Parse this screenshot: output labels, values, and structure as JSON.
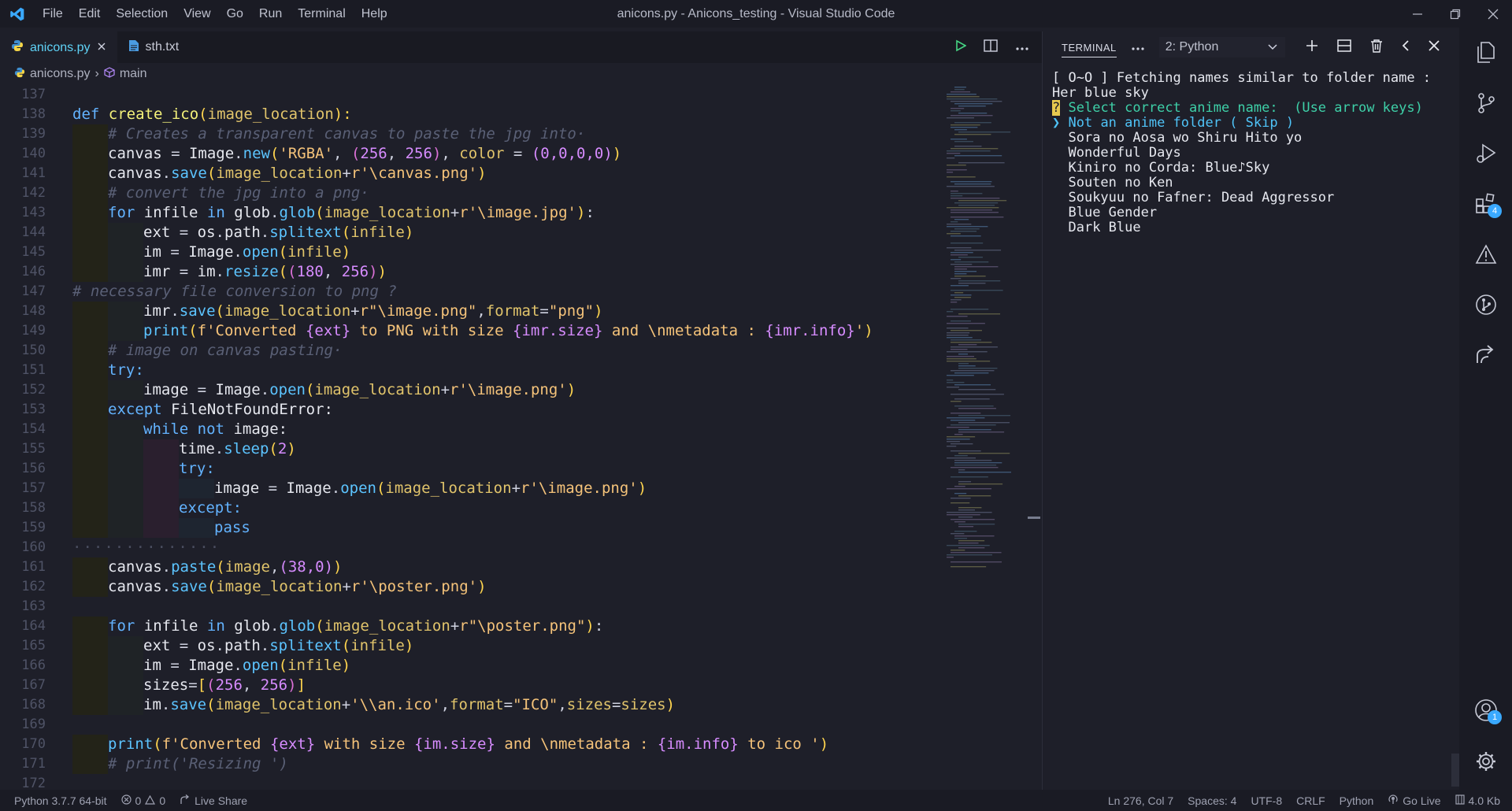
{
  "window": {
    "title": "anicons.py - Anicons_testing - Visual Studio Code",
    "menu": [
      "File",
      "Edit",
      "Selection",
      "View",
      "Go",
      "Run",
      "Terminal",
      "Help"
    ]
  },
  "tabs": [
    {
      "label": "anicons.py",
      "icon": "python-icon",
      "active": true
    },
    {
      "label": "sth.txt",
      "icon": "file-icon",
      "active": false
    }
  ],
  "breadcrumb": {
    "file": "anicons.py",
    "symbol": "main"
  },
  "editor": {
    "line_numbers": [
      "137",
      "138",
      "139",
      "140",
      "141",
      "142",
      "143",
      "144",
      "145",
      "146",
      "147",
      "148",
      "149",
      "150",
      "151",
      "152",
      "153",
      "154",
      "155",
      "156",
      "157",
      "158",
      "159",
      "160",
      "161",
      "162",
      "163",
      "164",
      "165",
      "166",
      "167",
      "168",
      "169",
      "170",
      "171",
      "172"
    ],
    "code": {
      "l137": "",
      "l138": {
        "kw": "def",
        "name": "create_ico",
        "param": "image_location",
        "end": "):"
      },
      "l139": "# Creates a transparent canvas to paste the jpg into·",
      "l140": {
        "a": "canvas",
        "b": "Image",
        "c": "new",
        "s": "'RGBA'",
        "n1": "256",
        "n2": "256",
        "k": "color",
        "t": "(0,0,0,0)"
      },
      "l141": {
        "a": "canvas",
        "m": "save",
        "p": "image_location",
        "s": "r'\\canvas.png'"
      },
      "l142": "# convert the jpg into a png·",
      "l143": {
        "kw": "for",
        "v": "infile",
        "kw2": "in",
        "g": "glob",
        "m": "glob",
        "p": "image_location",
        "s": "r'\\image.jpg'"
      },
      "l144": {
        "v": "ext",
        "o": "os",
        "pth": "path",
        "m": "splitext",
        "a": "infile"
      },
      "l145": {
        "v": "im",
        "c": "Image",
        "m": "open",
        "a": "infile"
      },
      "l146": {
        "v": "imr",
        "o": "im",
        "m": "resize",
        "n1": "180",
        "n2": "256"
      },
      "l147": "# necessary file conversion to png ?",
      "l148": {
        "v": "imr",
        "m": "save",
        "p": "image_location",
        "s": "r\"\\image.png\"",
        "k": "format",
        "s2": "\"png\""
      },
      "l149": {
        "fn": "print",
        "pre": "f'Converted ",
        "e1": "{ext}",
        "mid": " to PNG with size ",
        "e2": "{imr.size}",
        "mid2": " and \\nmetadata : ",
        "e3": "{imr.info}",
        "end": "'"
      },
      "l150": "# image on canvas pasting·",
      "l151": "try:",
      "l152": {
        "v": "image",
        "c": "Image",
        "m": "open",
        "p": "image_location",
        "s": "r'\\image.png'"
      },
      "l153": {
        "kw": "except",
        "err": "FileNotFoundError:"
      },
      "l154": {
        "kw": "while",
        "kw2": "not",
        "v": "image:"
      },
      "l155": {
        "o": "time",
        "m": "sleep",
        "n": "2"
      },
      "l156": "try:",
      "l157": {
        "v": "image",
        "c": "Image",
        "m": "open",
        "p": "image_location",
        "s": "r'\\image.png'"
      },
      "l158": "except:",
      "l159": "pass",
      "l160": "··············",
      "l161": {
        "a": "canvas",
        "m": "paste",
        "v": "image",
        "t": "(38,0)"
      },
      "l162": {
        "a": "canvas",
        "m": "save",
        "p": "image_location",
        "s": "r'\\poster.png'"
      },
      "l163": "",
      "l164": {
        "kw": "for",
        "v": "infile",
        "kw2": "in",
        "g": "glob",
        "m": "glob",
        "p": "image_location",
        "s": "r\"\\poster.png\""
      },
      "l165": {
        "v": "ext",
        "o": "os",
        "pth": "path",
        "m": "splitext",
        "a": "infile"
      },
      "l166": {
        "v": "im",
        "c": "Image",
        "m": "open",
        "a": "infile"
      },
      "l167": {
        "v": "sizes",
        "n1": "256",
        "n2": "256"
      },
      "l168": {
        "v": "im",
        "m": "save",
        "p": "image_location",
        "s": "'\\\\an.ico'",
        "k": "format",
        "s2": "\"ICO\"",
        "k2": "sizes",
        "v2": "sizes"
      },
      "l169": "",
      "l170": {
        "fn": "print",
        "pre": "f'Converted ",
        "e1": "{ext}",
        "mid": " with size ",
        "e2": "{im.size}",
        "mid2": " and \\nmetadata : ",
        "e3": "{im.info}",
        "end": " to ico '"
      },
      "l171": "# print('Resizing ')",
      "l172": ""
    }
  },
  "terminal": {
    "tab_label": "TERMINAL",
    "selected_shell": "2: Python",
    "lines": [
      "[ O~O ] Fetching names similar to folder name :  Her blue sky",
      "Select correct anime name:",
      "(Use arrow keys)",
      "Not an anime folder ( Skip )",
      "Sora no Aosa wo Shiru Hito yo",
      "Wonderful Days",
      "Kiniro no Corda: Blue♪Sky",
      "Souten no Ken",
      "Soukyuu no Fafner: Dead Aggressor",
      "Blue Gender",
      "Dark Blue"
    ],
    "prompt_mark": "?",
    "pointer": "❯"
  },
  "activity_bar": {
    "items": [
      "explorer-icon",
      "source-control-icon",
      "run-debug-icon",
      "extensions-icon",
      "problems-icon",
      "git-graph-icon",
      "live-share-icon"
    ],
    "extensions_badge": "4",
    "accounts_badge": "1"
  },
  "status_bar": {
    "python": "Python 3.7.7 64-bit",
    "errors": "0",
    "warnings": "0",
    "live_share": "Live Share",
    "position": "Ln 276, Col 7",
    "spaces": "Spaces: 4",
    "encoding": "UTF-8",
    "eol": "CRLF",
    "language": "Python",
    "go_live": "Go Live",
    "size": "4.0 Kb"
  },
  "colors": {
    "accent": "#5fd3f7",
    "background": "#1e1f29",
    "keyword": "#63b3ff",
    "function": "#f4f27a",
    "string": "#f5c37a",
    "number": "#d78cff"
  }
}
